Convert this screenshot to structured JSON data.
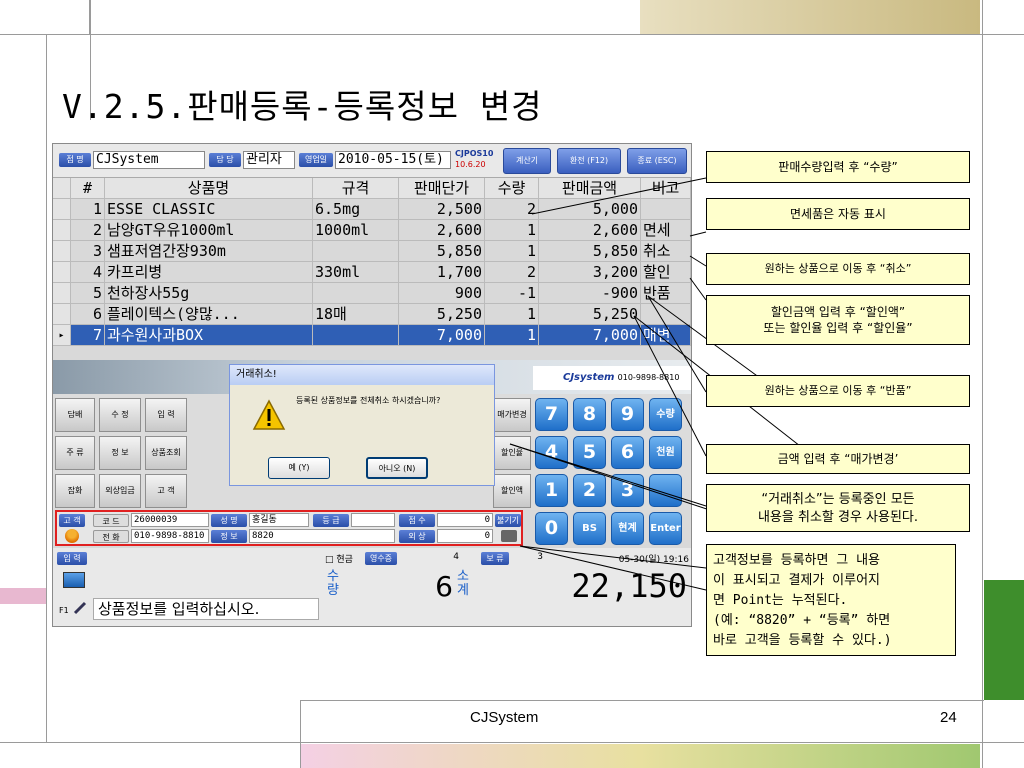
{
  "slide": {
    "title": "V.2.5.판매등록-등록정보 변경",
    "footer_center": "CJSystem",
    "page_number": "24"
  },
  "app": {
    "store_tag": "점 명",
    "store_value": "CJSystem",
    "clerk_tag": "담 당",
    "clerk_value": "관리자",
    "date_tag": "영업일",
    "date_value": "2010-05-15(토)",
    "version_name": "CJPOS10",
    "version_date": "10.6.20",
    "btn_calc": "계산기",
    "btn_exchange": "환전 (F12)",
    "btn_exit": "종료 (ESC)",
    "grid_headers": [
      "#",
      "상품명",
      "규격",
      "판매단가",
      "수량",
      "판매금액",
      "비고"
    ],
    "grid_rows": [
      [
        "1",
        "ESSE CLASSIC",
        "6.5mg",
        "2,500",
        "2",
        "5,000",
        ""
      ],
      [
        "2",
        "남양GT우유1000ml",
        "1000ml",
        "2,600",
        "1",
        "2,600",
        "면세"
      ],
      [
        "3",
        "샘표저염간장930m",
        "",
        "5,850",
        "1",
        "5,850",
        "취소"
      ],
      [
        "4",
        "카프리병",
        "330ml",
        "1,700",
        "2",
        "3,200",
        "할인"
      ],
      [
        "5",
        "천하장사55g",
        "",
        "900",
        "-1",
        "-900",
        "반품"
      ],
      [
        "6",
        "플레이텍스(양많...",
        "18매",
        "5,250",
        "1",
        "5,250",
        ""
      ],
      [
        "7",
        "과수원사과BOX",
        "",
        "7,000",
        "1",
        "7,000",
        "매변"
      ]
    ],
    "selected_marker": "▸",
    "logo_text": "CJsystem",
    "logo_phone": "010-9898-8810",
    "func_buttons": [
      [
        "담배",
        "수 정",
        "입 력"
      ],
      [
        "주 류",
        "정 보",
        "상품조회"
      ],
      [
        "잡화",
        "외상입금",
        "고 객"
      ]
    ],
    "side_buttons": [
      "매가변경",
      "할인율",
      "할인액"
    ],
    "numpad": [
      "7",
      "8",
      "9",
      "수량",
      "4",
      "5",
      "6",
      "천원",
      "1",
      "2",
      "3",
      "",
      "0",
      "BS",
      "현계",
      "Enter"
    ],
    "dialog": {
      "title": "거래취소!",
      "message": "등록된 상품정보를 전체취소 하시겠습니까?",
      "yes": "예 (Y)",
      "no": "아니오 (N)"
    },
    "customer": {
      "tag": "고 객",
      "code_tag": "코 드",
      "code_value": "26000039",
      "name_tag": "성 명",
      "name_value": "홍길동",
      "grade_tag": "등 급",
      "grade_value": "",
      "point_tag": "점 수",
      "point_value": "0",
      "phone_tag": "전 화",
      "phone_value": "010-9898-8810",
      "info_tag": "정 보",
      "info_value": "8820",
      "credit_tag": "외 상",
      "credit_value": "0",
      "load_button": "불기기"
    },
    "bottom": {
      "input_tag": "입 력",
      "f1_label": "F1",
      "status_message": "상품정보를 입력하십시오.",
      "cash_label": "□ 현금",
      "receipt_tag": "영수증",
      "receipt_value": "4",
      "hold_tag": "보 류",
      "hold_value": "3",
      "datetime": "05-30(일) 19:16",
      "qty_label": "수량",
      "qty_value": "6",
      "subtotal_label": "소계",
      "subtotal_value": "22,150"
    }
  },
  "callouts": [
    "판매수량입력 후 “수량”",
    "면세품은 자동 표시",
    "원하는 상품으로 이동 후 “취소”",
    "할인금액 입력 후 “할인액”",
    "또는 할인율 입력 후 “할인율”",
    "원하는 상품으로 이동 후 “반품”",
    "금액 입력 후 “매가변경’",
    "“거래취소”는 등록중인 모든",
    "내용을 취소할 경우 사용된다.",
    "고객정보를 등록하면 그 내용",
    "이 표시되고 결제가 이루어지",
    "면 Point는 누적된다.",
    "(예: “8820” + “등록” 하면",
    "바로 고객을 등록할 수 있다.)"
  ],
  "colors": {
    "selected_row": "#2f5fb5",
    "highlight_border": "#e02020",
    "callout_bg": "#ffffcc",
    "deco_green": "#3e8e2c",
    "deco_olive": "#c9b980",
    "deco_pink": "#e8b8d0"
  }
}
